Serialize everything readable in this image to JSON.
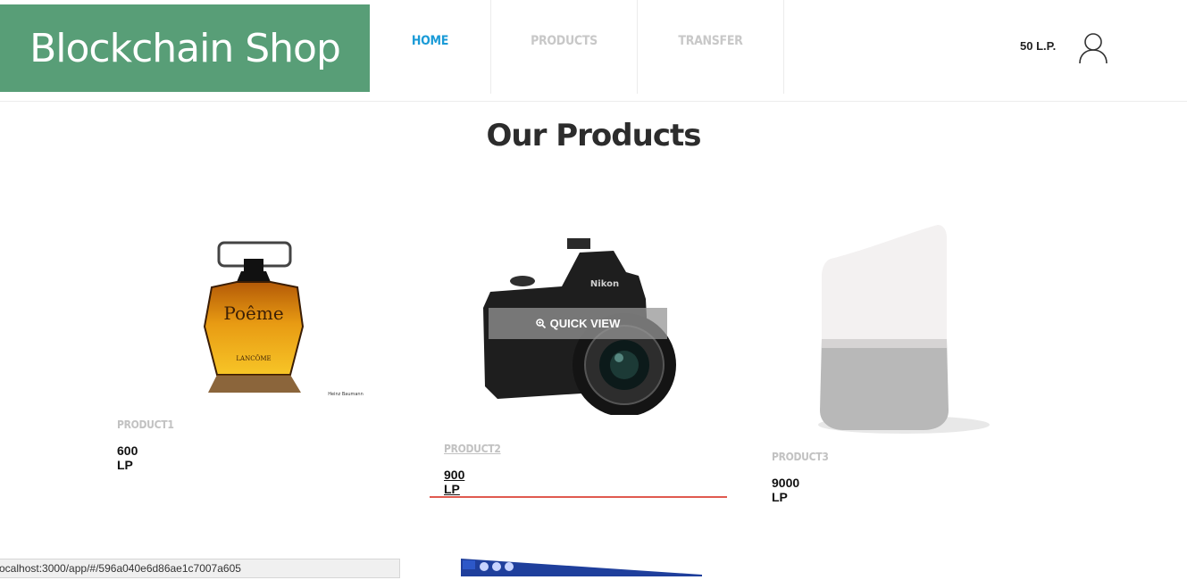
{
  "header": {
    "logo": "Blockchain Shop",
    "nav": [
      {
        "label": "HOME",
        "active": true
      },
      {
        "label": "PRODUCTS",
        "active": false
      },
      {
        "label": "TRANSFER",
        "active": false
      }
    ],
    "balance": "50 L.P.",
    "user_icon": "user-icon"
  },
  "main": {
    "title": "Our Products",
    "quick_view_label": "QUICK VIEW",
    "products": [
      {
        "name": "PRODUCT1",
        "price": "600 LP",
        "image": "perfume-bottle",
        "label": "Poême",
        "brand": "LANCÔME",
        "credit": "Heinz Baumann"
      },
      {
        "name": "PRODUCT2",
        "price": "900 LP",
        "image": "camera",
        "brand": "Nikon"
      },
      {
        "name": "PRODUCT3",
        "price": "9000 LP",
        "image": "smart-speaker"
      }
    ]
  },
  "status_bar": {
    "url": "ocalhost:3000/app/#/596a040e6d86ae1c7007a605"
  },
  "colors": {
    "logo_bg": "#589e77",
    "nav_active": "#1b9bd7",
    "hover_line": "#e05a4f"
  }
}
